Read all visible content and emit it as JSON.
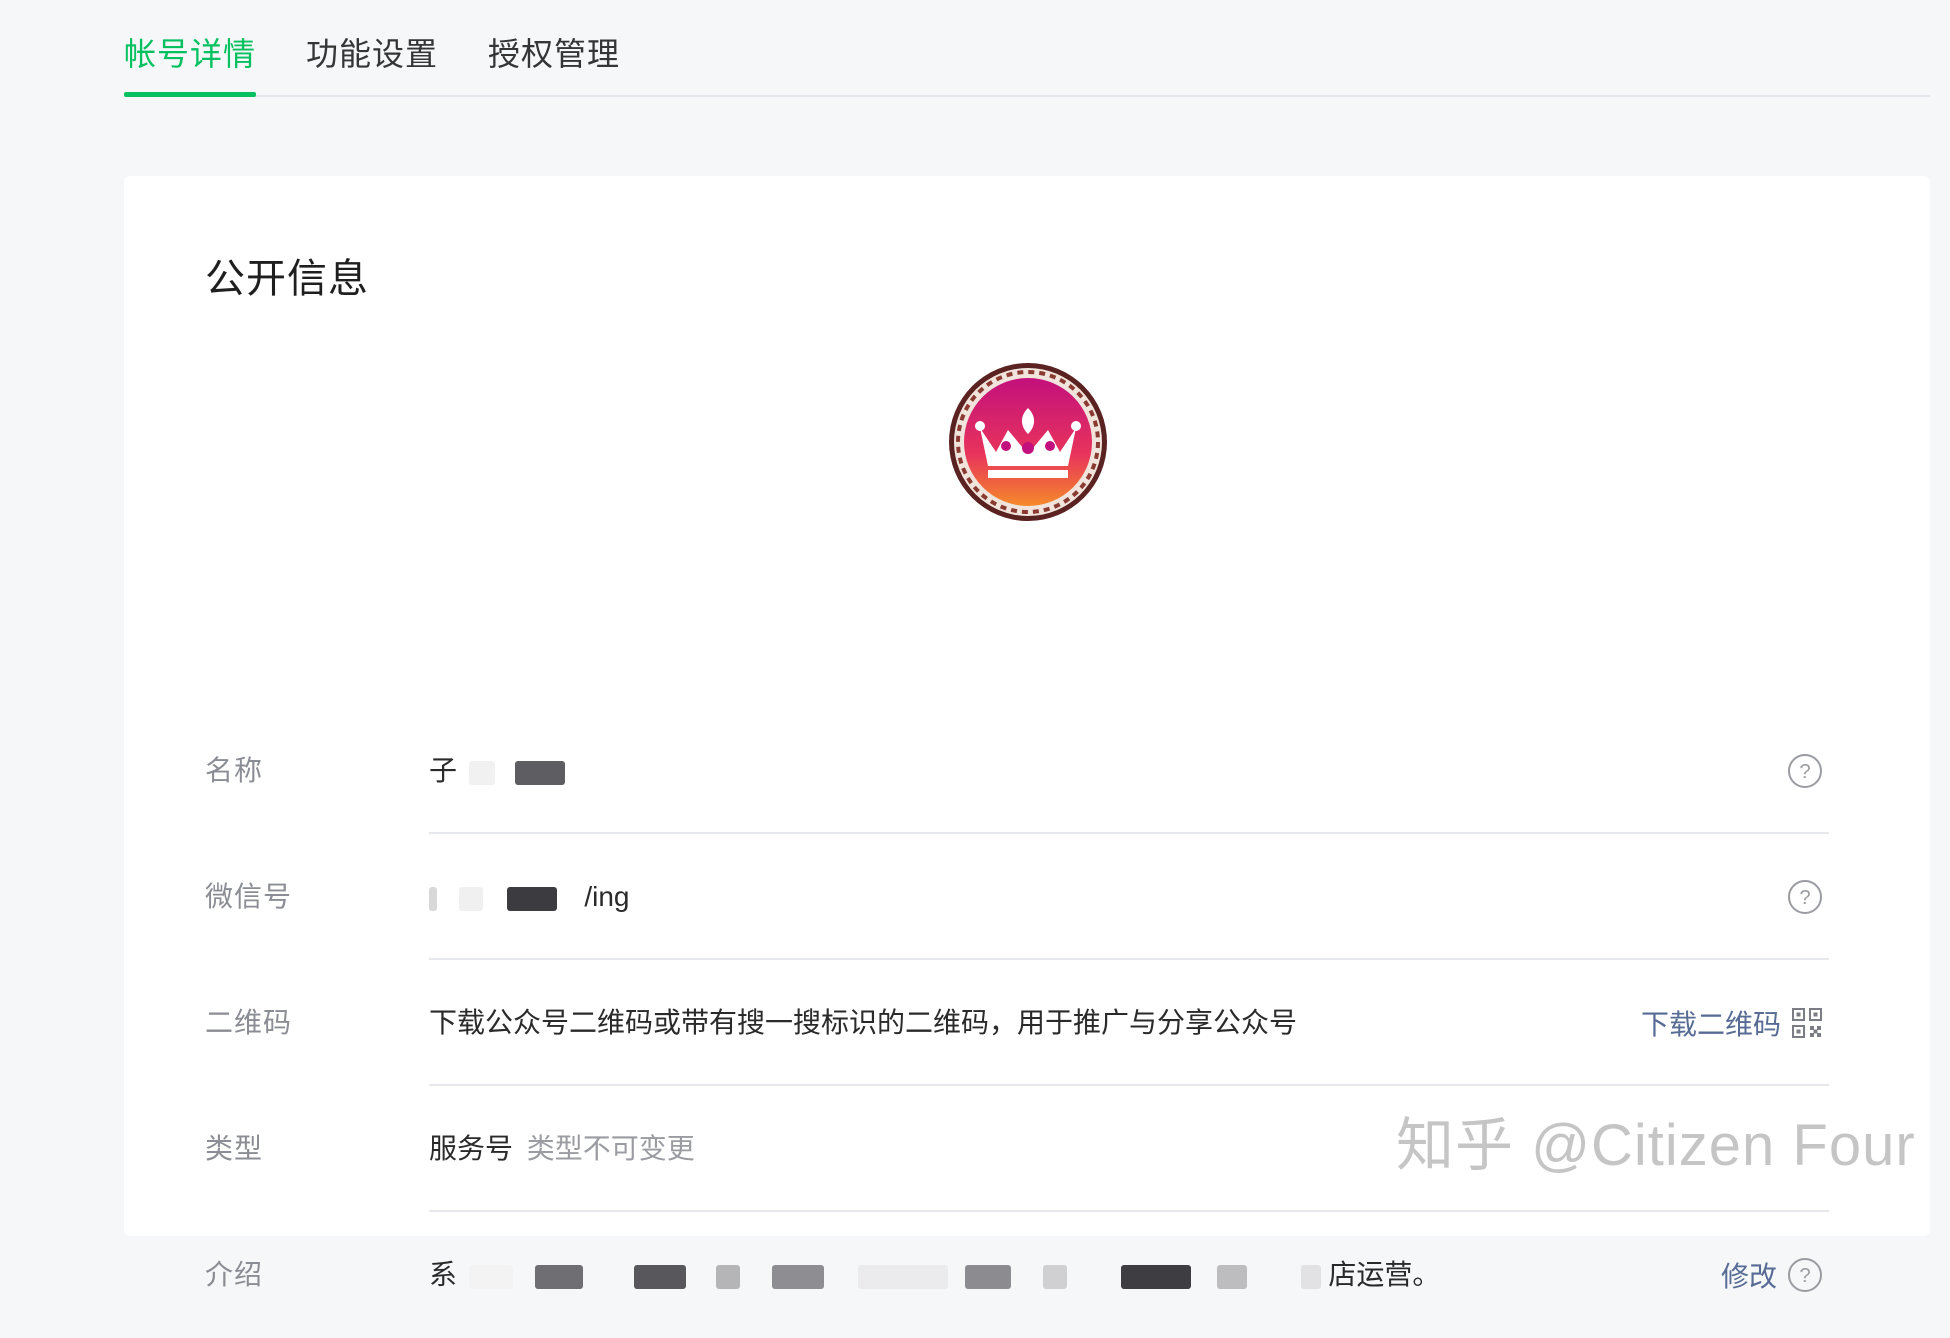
{
  "tabs": [
    {
      "label": "帐号详情",
      "active": true
    },
    {
      "label": "功能设置",
      "active": false
    },
    {
      "label": "授权管理",
      "active": false
    }
  ],
  "section_title": "公开信息",
  "rows": {
    "name": {
      "label": "名称",
      "value_prefix": "子"
    },
    "wechat_id": {
      "label": "微信号",
      "value_suffix": "/ing"
    },
    "qrcode": {
      "label": "二维码",
      "description": "下载公众号二维码或带有搜一搜标识的二维码，用于推广与分享公众号",
      "download_link": "下载二维码"
    },
    "type": {
      "label": "类型",
      "value": "服务号",
      "note": "类型不可变更"
    },
    "intro": {
      "label": "介绍",
      "value_prefix": "系",
      "value_suffix": "店运营。",
      "edit_link": "修改"
    }
  },
  "watermark": "知乎 @Citizen Four",
  "colors": {
    "accent_green": "#07c160",
    "link_blue": "#576b95"
  }
}
